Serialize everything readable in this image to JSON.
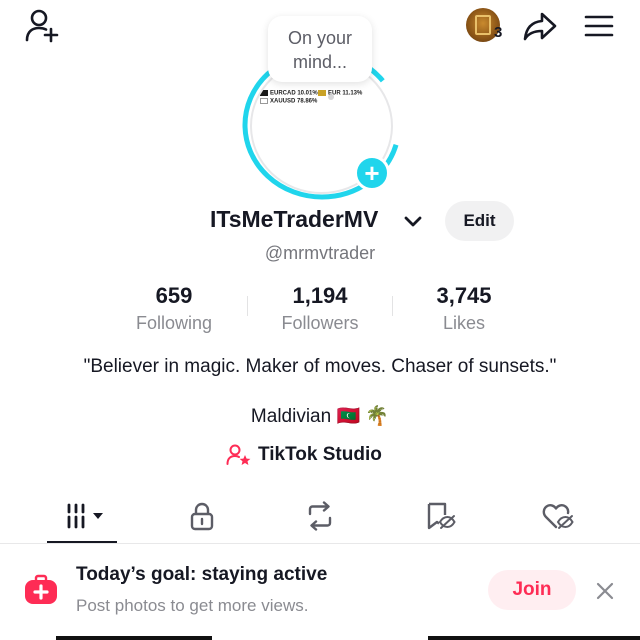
{
  "top_bar": {
    "add_friend_icon": "person-add-icon",
    "story_count": "3",
    "share_icon": "share-arrow-icon",
    "menu_icon": "hamburger-menu-icon"
  },
  "avatar": {
    "bubble_text": "On your mind...",
    "legend": [
      {
        "label": "EURCAD 10.01%",
        "color": "#1a1a1a"
      },
      {
        "label": "EUR 11.13%",
        "color": "#c9a227"
      },
      {
        "label": "XAUUSD 78.86%",
        "color": "#ffffff"
      }
    ],
    "ring_color": "#20d5ec",
    "add_photo_label": "+"
  },
  "profile": {
    "display_name": "ITsMeTraderMV",
    "handle": "@mrmvtrader",
    "edit_label": "Edit"
  },
  "stats": [
    {
      "value": "659",
      "label": "Following"
    },
    {
      "value": "1,194",
      "label": "Followers"
    },
    {
      "value": "3,745",
      "label": "Likes"
    }
  ],
  "bio": {
    "text": "\"Believer in magic. Maker of moves. Chaser of sunsets.\"",
    "location": "Maldivian 🇲🇻 🌴"
  },
  "studio": {
    "label": "TikTok Studio",
    "icon": "person-star-icon",
    "icon_color": "#fe2c55"
  },
  "tabs": [
    {
      "name": "videos",
      "icon": "grid-bars-icon",
      "active": true
    },
    {
      "name": "private",
      "icon": "lock-icon",
      "active": false
    },
    {
      "name": "reposts",
      "icon": "repost-icon",
      "active": false
    },
    {
      "name": "favorites",
      "icon": "bookmark-hidden-icon",
      "active": false
    },
    {
      "name": "liked",
      "icon": "heart-hidden-icon",
      "active": false
    }
  ],
  "goal_banner": {
    "title": "Today’s goal: staying active",
    "subtitle": "Post photos to get more views.",
    "join_label": "Join",
    "accent": "#fe2c55"
  }
}
